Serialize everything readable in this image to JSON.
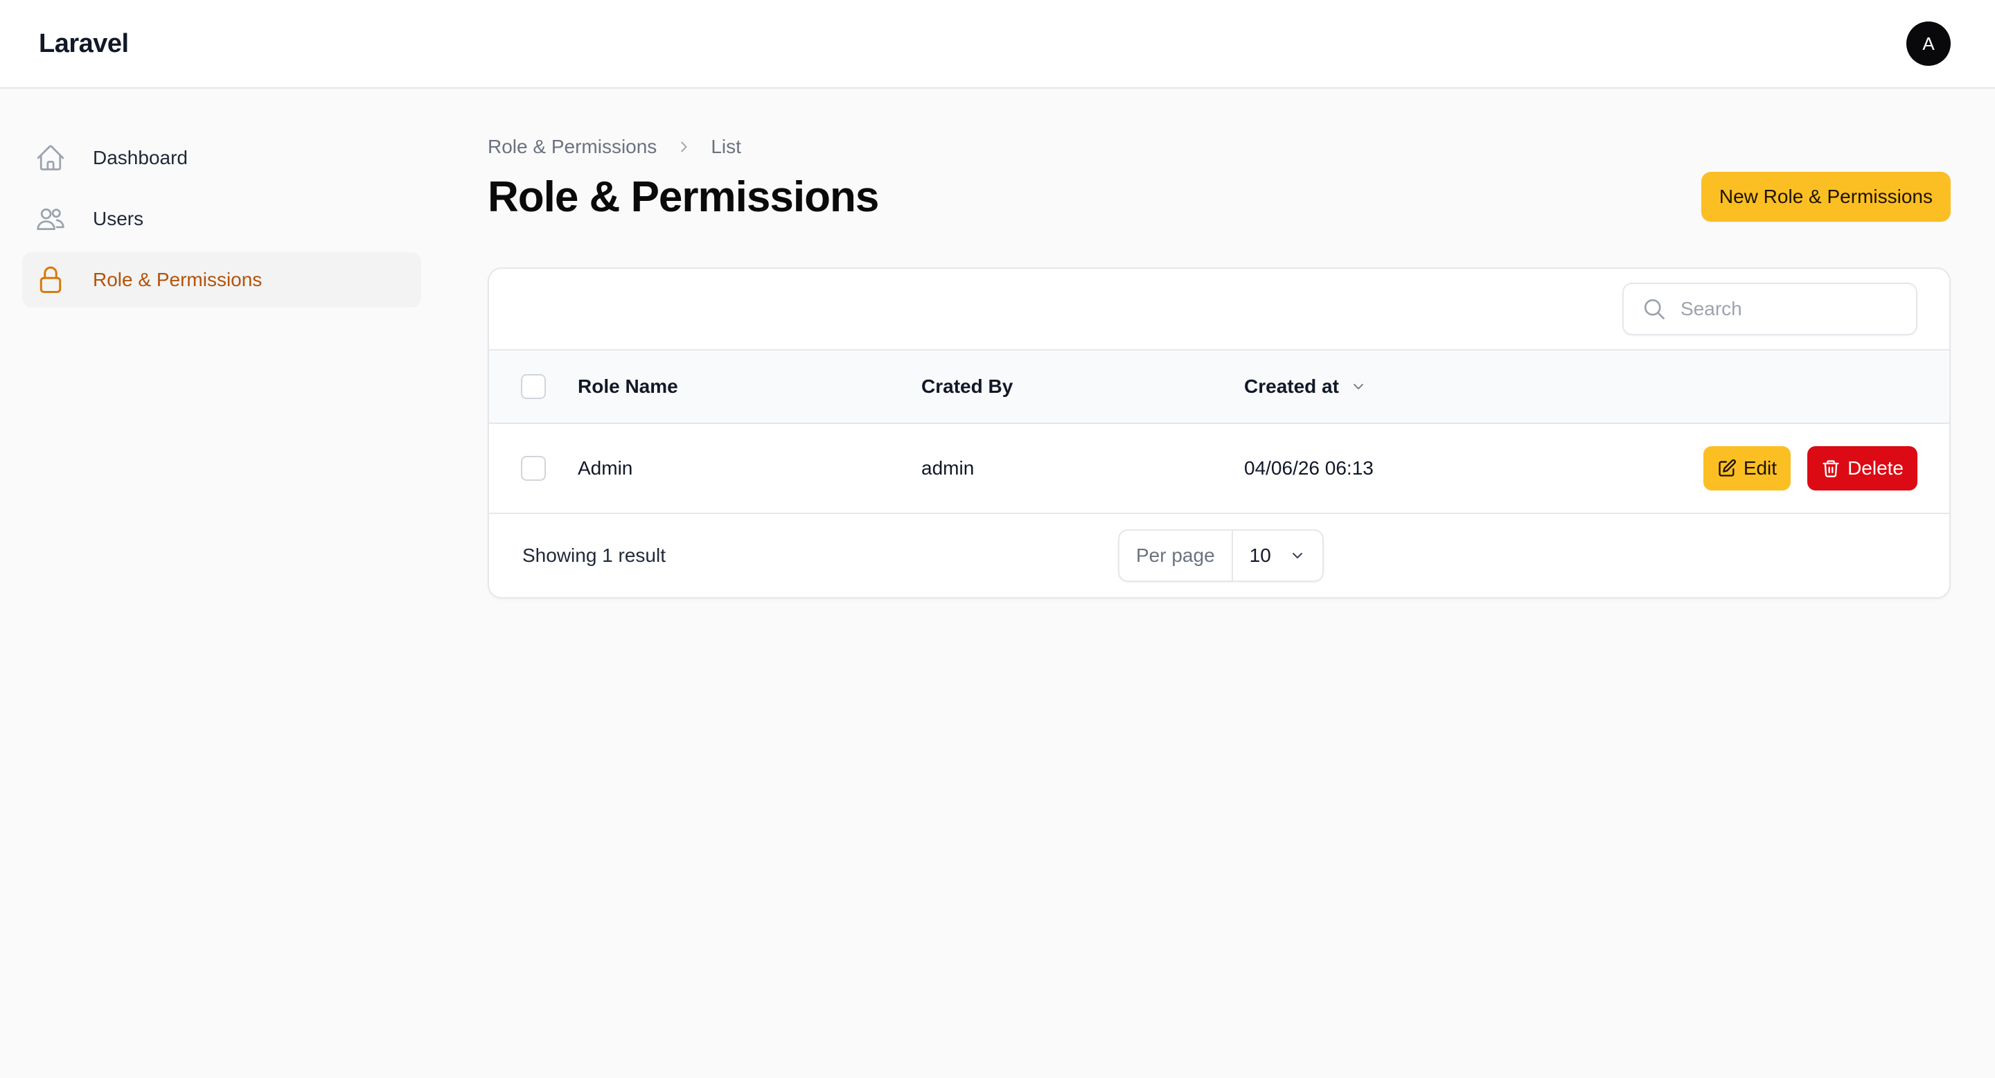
{
  "topbar": {
    "brand": "Laravel",
    "avatar_initial": "A"
  },
  "sidebar": {
    "items": [
      {
        "label": "Dashboard",
        "icon": "home-icon",
        "active": false
      },
      {
        "label": "Users",
        "icon": "users-icon",
        "active": false
      },
      {
        "label": "Role & Permissions",
        "icon": "lock-icon",
        "active": true
      }
    ]
  },
  "breadcrumb": {
    "items": [
      "Role & Permissions",
      "List"
    ]
  },
  "page": {
    "title": "Role & Permissions",
    "new_button": "New Role & Permissions"
  },
  "search": {
    "placeholder": "Search",
    "value": ""
  },
  "table": {
    "columns": [
      "Role Name",
      "Crated By",
      "Created at"
    ],
    "rows": [
      {
        "role_name": "Admin",
        "created_by": "admin",
        "created_at": "04/06/26 06:13"
      }
    ],
    "actions": {
      "edit": "Edit",
      "delete": "Delete"
    }
  },
  "footer": {
    "showing": "Showing 1 result",
    "per_page_label": "Per page",
    "per_page_value": "10"
  },
  "colors": {
    "accent": "#fbbf24",
    "danger": "#dc0a14",
    "active_text": "#b45309"
  }
}
